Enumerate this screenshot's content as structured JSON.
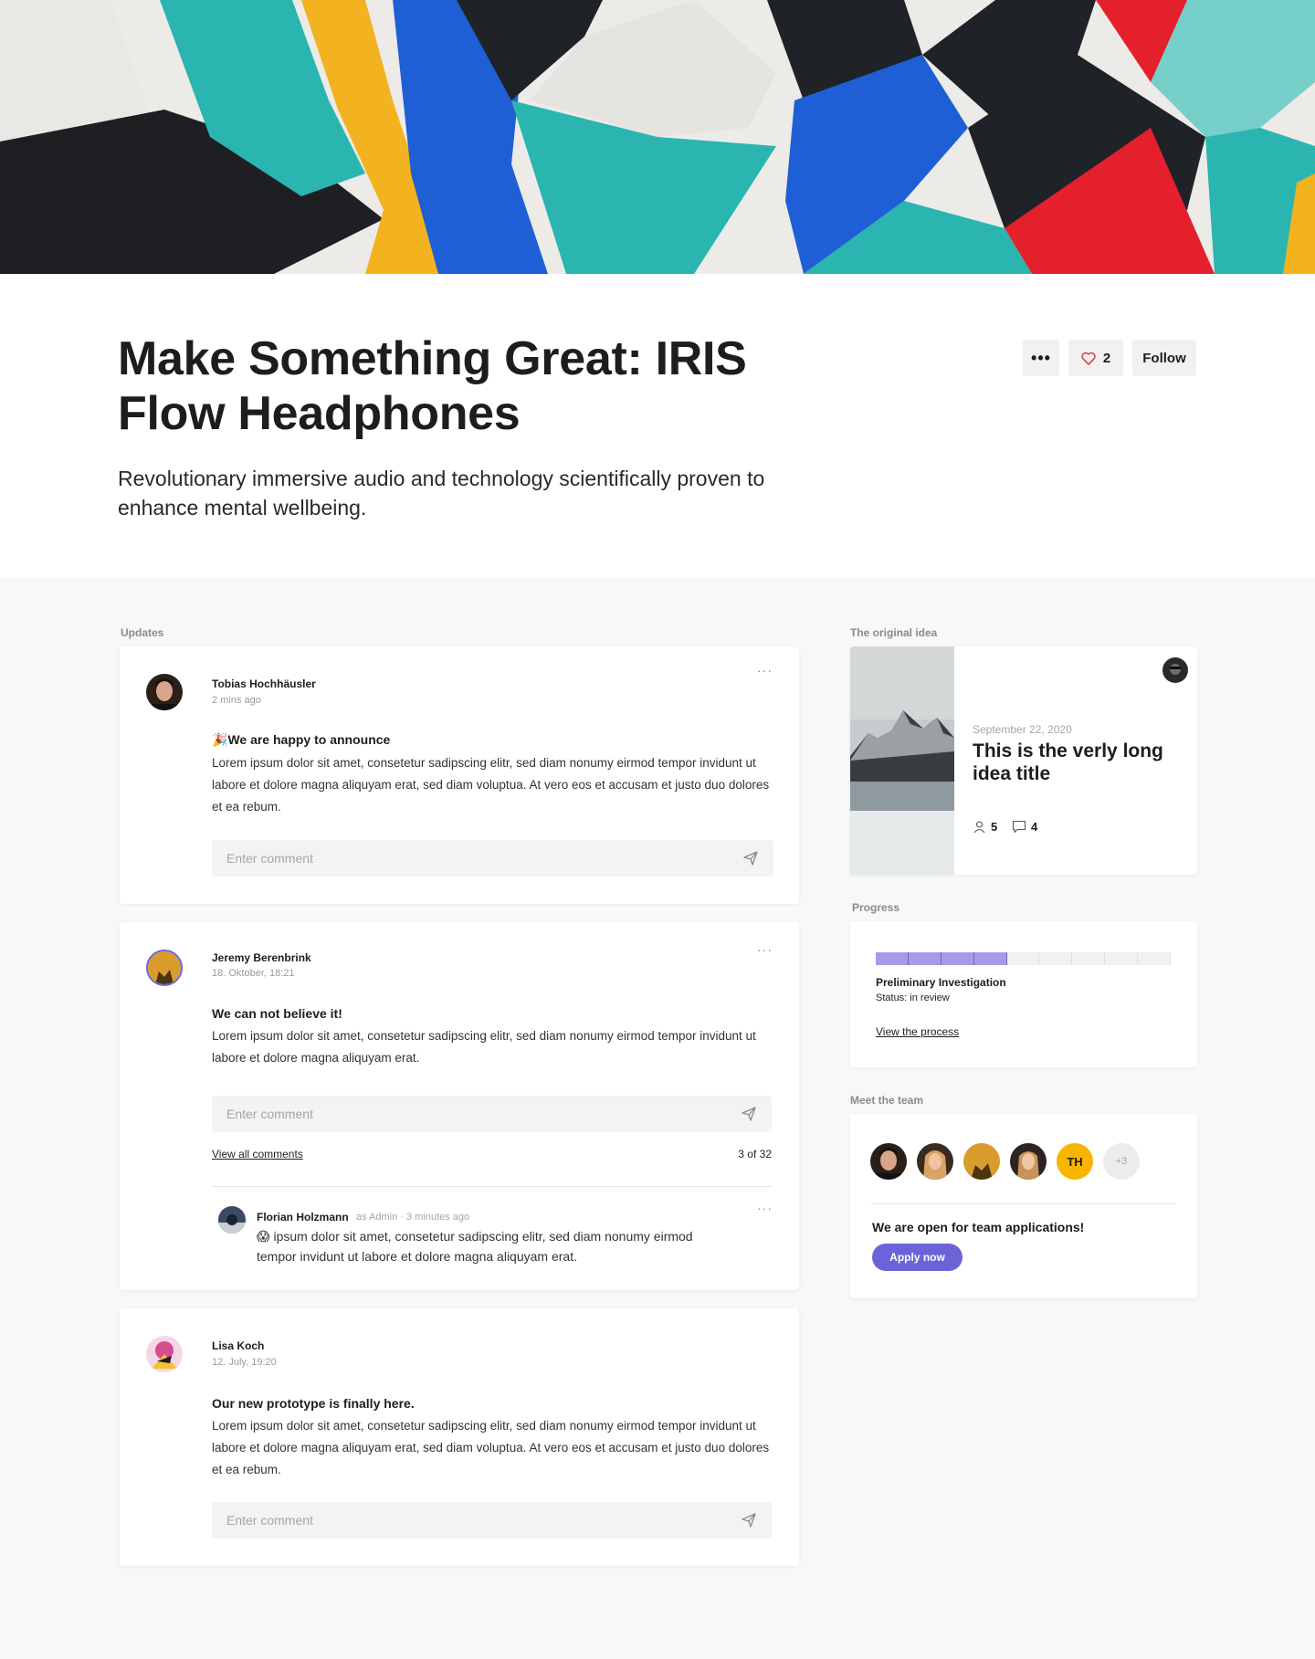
{
  "header": {
    "title": "Make Something Great: IRIS Flow Headphones",
    "subtitle": "Revolutionary immersive audio and technology scientifically proven to enhance mental wellbeing.",
    "more_label": "•••",
    "likes": "2",
    "follow_label": "Follow"
  },
  "updates": {
    "label": "Updates",
    "posts": [
      {
        "author": "Tobias Hochhäusler",
        "time": "2 mins ago",
        "title_emoji": "🎉",
        "title": "We are happy to announce",
        "body": "Lorem ipsum dolor sit amet, consetetur sadipscing elitr, sed diam nonumy eirmod tempor invidunt ut labore et dolore magna aliquyam erat, sed diam voluptua. At vero eos et accusam et justo duo dolores et ea rebum.",
        "comment_placeholder": "Enter comment"
      },
      {
        "author": "Jeremy Berenbrink",
        "time": "18. Oktober, 18:21",
        "title": "We can not believe it!",
        "body": "Lorem ipsum dolor sit amet, consetetur sadipscing elitr, sed diam nonumy eirmod tempor invidunt ut labore et dolore magna aliquyam erat.",
        "comment_placeholder": "Enter comment",
        "view_all_label": "View all comments",
        "comment_count": "3 of 32",
        "reply": {
          "author": "Florian Holzmann",
          "role": "as Admin",
          "sep": "·",
          "time": "3 minutes ago",
          "body": "😱 ipsum dolor sit amet, consetetur sadipscing elitr, sed diam nonumy eirmod tempor invidunt ut labore et dolore magna aliquyam erat."
        }
      },
      {
        "author": "Lisa Koch",
        "time": "12. July, 19:20",
        "title": "Our new prototype is finally here.",
        "body": "Lorem ipsum dolor sit amet, consetetur sadipscing elitr, sed diam nonumy eirmod tempor invidunt ut labore et dolore magna aliquyam erat, sed diam voluptua. At vero eos et accusam et justo duo dolores et ea rebum.",
        "comment_placeholder": "Enter comment"
      }
    ]
  },
  "idea": {
    "label": "The original idea",
    "date": "September 22, 2020",
    "title": "This is the verly long idea title",
    "members": "5",
    "comments": "4"
  },
  "progress": {
    "label": "Progress",
    "stage": "Preliminary Investigation",
    "status": "Status: in review",
    "link": "View the process",
    "completed_segments": 4,
    "total_segments": 9
  },
  "team": {
    "label": "Meet the team",
    "initials": "TH",
    "extra": "+3",
    "open_text": "We are open for team applications!",
    "apply_label": "Apply now"
  },
  "colors": {
    "accent": "#6d63d9",
    "progress_fill": "#a59ce8",
    "initials_bg": "#f7b500",
    "like_heart": "#e0454b"
  }
}
